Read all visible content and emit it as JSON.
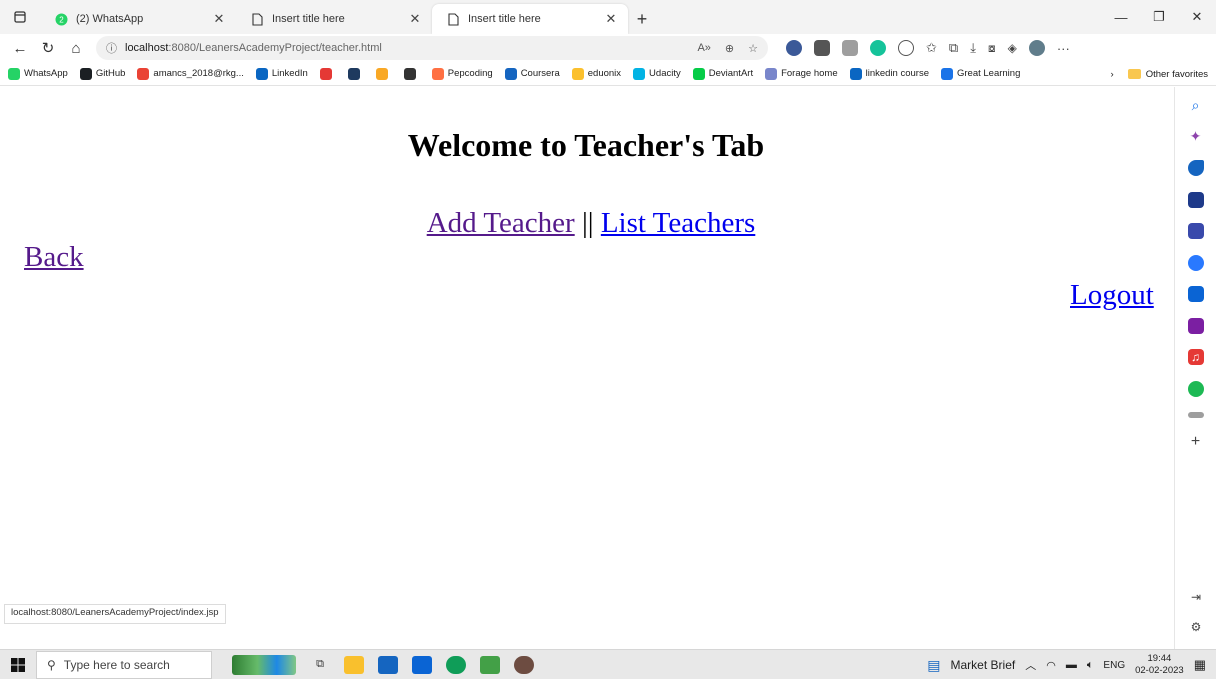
{
  "browser": {
    "tabs": [
      {
        "title": "(2) WhatsApp",
        "active": false
      },
      {
        "title": "Insert title here",
        "active": false
      },
      {
        "title": "Insert title here",
        "active": true
      }
    ],
    "address": {
      "host": "localhost",
      "path": ":8080/LeanersAcademyProject/teacher.html"
    },
    "bookmarks": [
      {
        "label": "WhatsApp",
        "color": "#25d366"
      },
      {
        "label": "GitHub",
        "color": "#1b1f23"
      },
      {
        "label": "amancs_2018@rkg...",
        "color": "#ea4335"
      },
      {
        "label": "LinkedIn",
        "color": "#0a66c2"
      },
      {
        "label": "",
        "color": "#e53935"
      },
      {
        "label": "",
        "color": "#1e3a5f"
      },
      {
        "label": "",
        "color": "#f9a825"
      },
      {
        "label": "",
        "color": "#333333"
      },
      {
        "label": "Pepcoding",
        "color": "#ff7043"
      },
      {
        "label": "Coursera",
        "color": "#1565c0"
      },
      {
        "label": "eduonix",
        "color": "#fbc02d"
      },
      {
        "label": "Udacity",
        "color": "#02b3e4"
      },
      {
        "label": "DeviantArt",
        "color": "#05cc47"
      },
      {
        "label": "Forage home",
        "color": "#7986cb"
      },
      {
        "label": "linkedin course",
        "color": "#0a66c2"
      },
      {
        "label": "Great Learning",
        "color": "#1a73e8"
      }
    ],
    "other_favorites": "Other favorites",
    "status_url": "localhost:8080/LeanersAcademyProject/index.jsp"
  },
  "page": {
    "title": "Welcome to Teacher's Tab",
    "add_teacher": "Add Teacher",
    "separator": "||",
    "list_teachers": "List Teachers",
    "back": "Back",
    "logout": "Logout"
  },
  "taskbar": {
    "search_placeholder": "Type here to search",
    "market_brief": "Market Brief",
    "language": "ENG",
    "time": "19:44",
    "date": "02-02-2023"
  },
  "colors": {
    "link": "#0000ee",
    "visited_link": "#551a8b"
  }
}
